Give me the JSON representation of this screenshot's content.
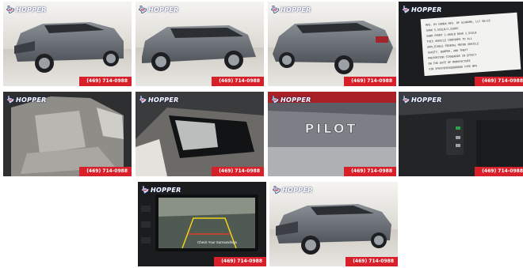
{
  "dealer": {
    "logo_text": "HOPPER",
    "phone": "(469) 714-0988"
  },
  "photos": [
    {
      "id": "exterior-front-left"
    },
    {
      "id": "exterior-side-left"
    },
    {
      "id": "exterior-rear-left"
    },
    {
      "id": "door-jamb-sticker",
      "sticker_lines": [
        "MFD. BY HONDA MFG. OF ALABAMA, LLC    06/16",
        "GVWR   5,555LB/2,520KG",
        "GAWR FRONT 2,668LB  REAR 2,932LB",
        "THIS VEHICLE CONFORMS TO ALL",
        "APPLICABLE FEDERAL MOTOR VEHICLE",
        "SAFETY, BUMPER, AND THEFT",
        "PREVENTION STANDARDS IN EFFECT",
        "ON THE DATE OF MANUFACTURE",
        "VIN 5FNYF5H55GB000000   TYPE MPV"
      ]
    },
    {
      "id": "interior-front-seat"
    },
    {
      "id": "sunroof"
    },
    {
      "id": "pilot-badge",
      "badge_text": "PILOT"
    },
    {
      "id": "dash-buttons"
    },
    {
      "id": "backup-camera",
      "screen_text": "Check Your Surroundings"
    },
    {
      "id": "exterior-front-left-2"
    }
  ],
  "colors": {
    "phone_bg": "#d7202a",
    "car_body": "#6f747a",
    "floor": "#d9d6d0",
    "wall": "#ecebe8"
  }
}
